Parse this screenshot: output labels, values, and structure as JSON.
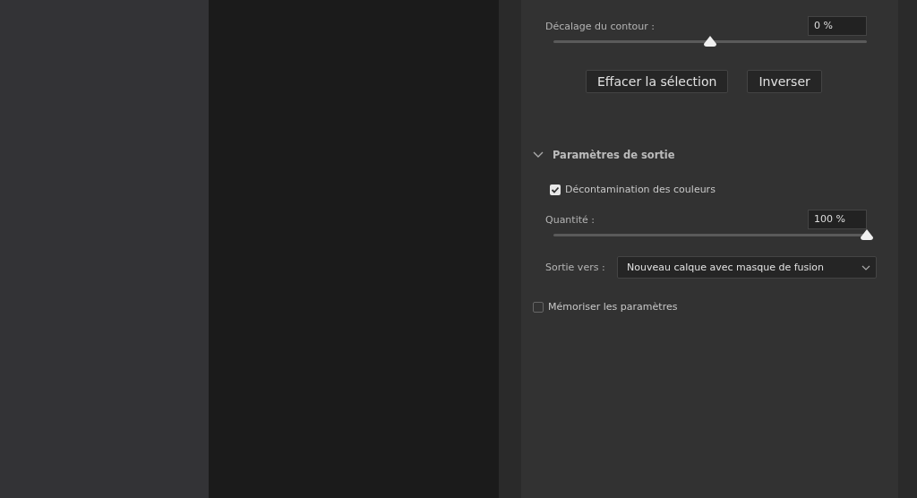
{
  "edge_shift": {
    "label": "Décalage du contour :",
    "value": "0 %",
    "level": 0.5
  },
  "buttons": [
    "Effacer la sélection",
    "Inverser"
  ],
  "output_section": {
    "title": "Paramètres de sortie",
    "expanded": true,
    "decontaminate": {
      "label": "Décontamination des couleurs",
      "checked": true
    },
    "amount": {
      "label": "Quantité :",
      "value": "100 %",
      "level": 1
    },
    "output_to": {
      "label": "Sortie vers :",
      "value": "Nouveau calque avec masque de fusion"
    }
  },
  "remember": {
    "label": "Mémoriser les paramètres",
    "checked": false
  }
}
